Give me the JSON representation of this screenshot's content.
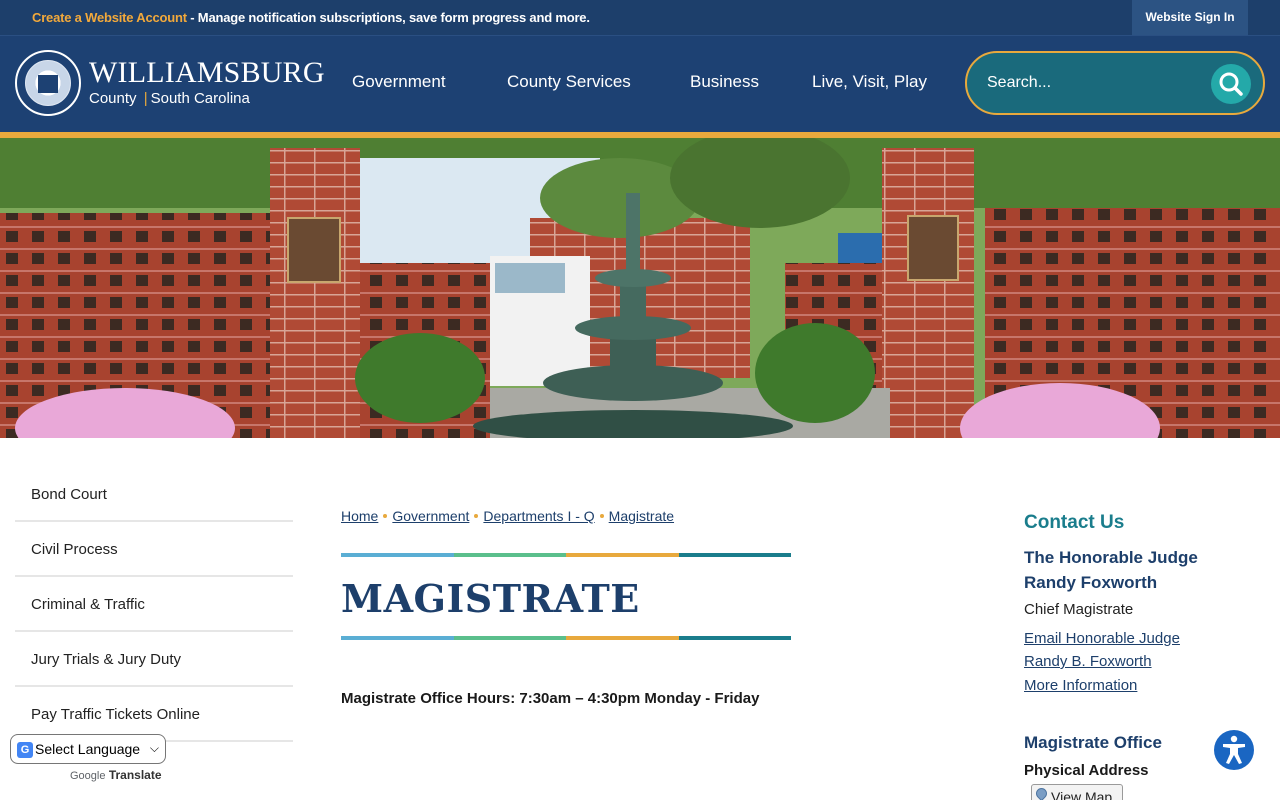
{
  "topbar": {
    "create_account": "Create a Website Account",
    "message": " - Manage notification subscriptions, save form progress and more.",
    "signin": "Website Sign In"
  },
  "header": {
    "brand_title": "WILLIAMSBURG",
    "brand_county": "County",
    "brand_separator": "|",
    "brand_state": "South Carolina",
    "nav": [
      "Government",
      "County Services",
      "Business",
      "Live, Visit, Play"
    ],
    "search_placeholder": "Search...",
    "seal_icon": "county-seal",
    "search_icon": "search-icon",
    "accent_color": "#e8a93d",
    "brand_color": "#1d4173"
  },
  "sidebar": {
    "items": [
      "Bond Court",
      "Civil Process",
      "Criminal & Traffic",
      "Jury Trials & Jury Duty",
      "Pay Traffic Tickets Online"
    ]
  },
  "translate": {
    "select_value": "Select Language",
    "powered_prefix": "Google",
    "powered_label": "Translate"
  },
  "main": {
    "breadcrumb": [
      "Home",
      "Government",
      "Departments I - Q",
      "Magistrate"
    ],
    "title": "MAGISTRATE",
    "hours": "Magistrate Office Hours: 7:30am – 4:30pm Monday - Friday",
    "rule_colors": [
      "#5aaed4",
      "#5bbf8c",
      "#e8a93d",
      "#1a7d8c"
    ]
  },
  "contact": {
    "heading": "Contact Us",
    "judge_name": "The Honorable Judge Randy Foxworth",
    "judge_title": "Chief Magistrate",
    "email_link": "Email Honorable Judge Randy B. Foxworth",
    "more_info": "More Information",
    "office_heading": "Magistrate Office",
    "address_heading": "Physical Address",
    "view_map": "View Map"
  }
}
